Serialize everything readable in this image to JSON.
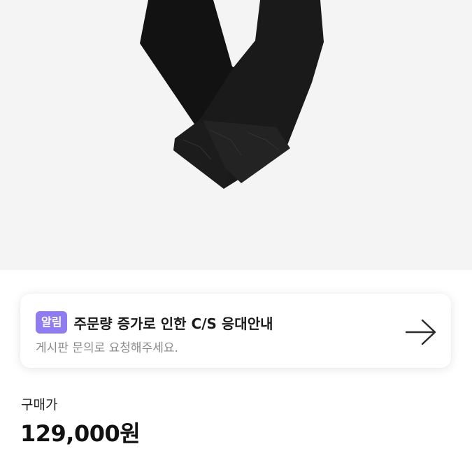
{
  "notice": {
    "badge": "알림",
    "title": "주문량 증가로 인한 C/S 응대안내",
    "subtitle": "게시판 문의로 요청해주세요.",
    "arrow_icon": "arrow-right-icon"
  },
  "price": {
    "label": "구매가",
    "value": "129,000원"
  },
  "colors": {
    "badge_bg": "#8e7cf0",
    "image_bg": "#f4f4f4"
  }
}
